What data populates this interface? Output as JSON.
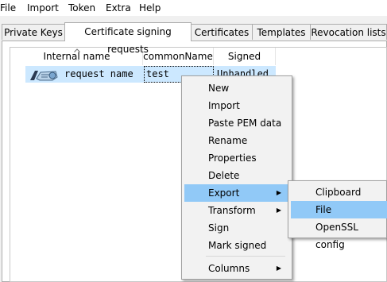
{
  "menubar": [
    "File",
    "Import",
    "Token",
    "Extra",
    "Help"
  ],
  "tabs": [
    "Private Keys",
    "Certificate signing requests",
    "Certificates",
    "Templates",
    "Revocation lists"
  ],
  "table": {
    "columns": [
      "Internal name",
      "commonName",
      "Signed"
    ],
    "rows": [
      {
        "internal_name": "request name",
        "common_name": "test",
        "signed": "Unhandled"
      }
    ]
  },
  "icons": {
    "row_icon": "csr-key-icon",
    "submenu_arrow": "chevron-right-icon",
    "sort_arrow": "sort-ascending-icon"
  },
  "context_menu": {
    "items": [
      "New",
      "Import",
      "Paste PEM data",
      "Rename",
      "Properties",
      "Delete",
      "Export",
      "Transform",
      "Sign",
      "Mark signed",
      "Columns"
    ],
    "highlighted": "Export"
  },
  "export_submenu": {
    "items": [
      "Clipboard",
      "File",
      "OpenSSL config"
    ],
    "highlighted": "File"
  },
  "colors": {
    "selection": "#cce8ff",
    "menu_highlight": "#91c9f7",
    "menu_background": "#f2f2f2"
  }
}
